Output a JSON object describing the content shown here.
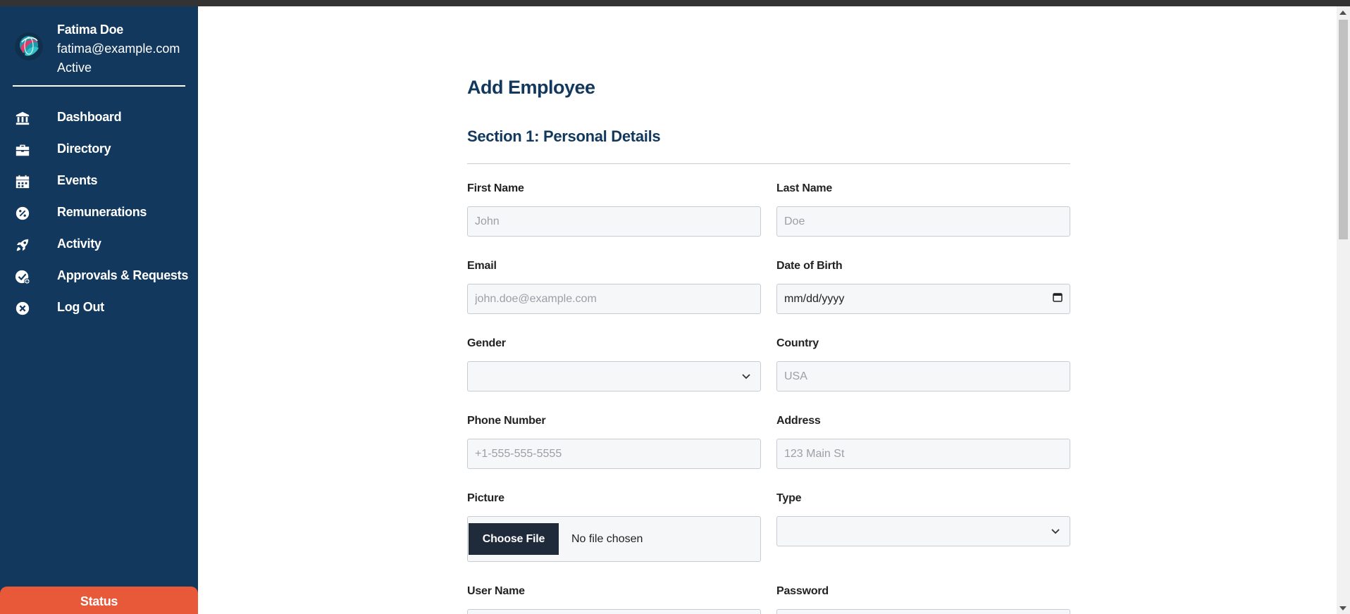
{
  "user": {
    "name": "Fatima Doe",
    "email": "fatima@example.com",
    "status": "Active"
  },
  "nav": {
    "items": [
      {
        "label": "Dashboard",
        "icon": "bank-icon"
      },
      {
        "label": "Directory",
        "icon": "briefcase-icon"
      },
      {
        "label": "Events",
        "icon": "calendar-icon"
      },
      {
        "label": "Remunerations",
        "icon": "percent-badge-icon"
      },
      {
        "label": "Activity",
        "icon": "rocket-icon"
      },
      {
        "label": "Approvals & Requests",
        "icon": "check-globe-icon"
      },
      {
        "label": "Log Out",
        "icon": "close-circle-icon"
      }
    ]
  },
  "status_button": "Status",
  "page": {
    "title": "Add Employee",
    "section1_title": "Section 1: Personal Details"
  },
  "form": {
    "first_name": {
      "label": "First Name",
      "placeholder": "John"
    },
    "last_name": {
      "label": "Last Name",
      "placeholder": "Doe"
    },
    "email": {
      "label": "Email",
      "placeholder": "john.doe@example.com"
    },
    "dob": {
      "label": "Date of Birth",
      "placeholder": "mm/dd/yyyy"
    },
    "gender": {
      "label": "Gender",
      "value": ""
    },
    "country": {
      "label": "Country",
      "placeholder": "USA"
    },
    "phone": {
      "label": "Phone Number",
      "placeholder": "+1-555-555-5555"
    },
    "address": {
      "label": "Address",
      "placeholder": "123 Main St"
    },
    "picture": {
      "label": "Picture",
      "button": "Choose File",
      "status": "No file chosen"
    },
    "type": {
      "label": "Type",
      "value": ""
    },
    "username": {
      "label": "User Name"
    },
    "password": {
      "label": "Password"
    }
  },
  "colors": {
    "sidebar": "#12395d",
    "accent": "#e8593a",
    "title": "#12395d"
  }
}
